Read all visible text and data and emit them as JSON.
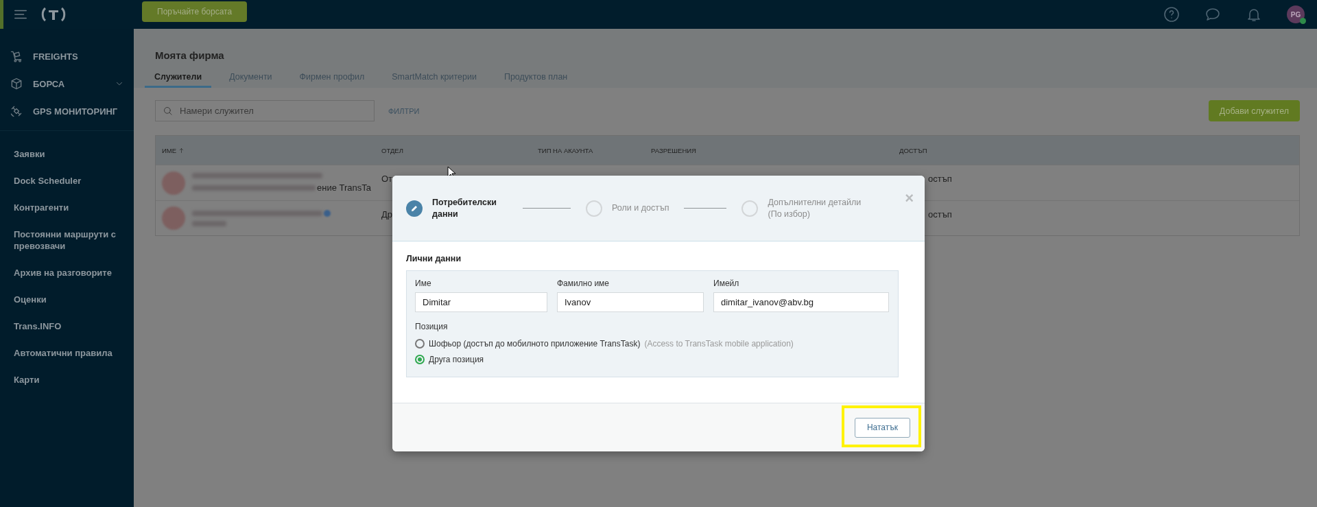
{
  "topbar": {
    "order_button": "Поръчайте борсата",
    "avatar": "PG",
    "online": true
  },
  "sidebar": {
    "main_items": [
      {
        "label": "FREIGHTS",
        "kind": "freights",
        "expandable": false
      },
      {
        "label": "БОРСА",
        "kind": "exchange",
        "expandable": true
      },
      {
        "label": "GPS МОНИТОРИНГ",
        "kind": "gps",
        "expandable": false
      }
    ],
    "items": [
      "Заявки",
      "Dock Scheduler",
      "Контрагенти",
      "Постоянни маршрути с превозвачи",
      "Архив на разговорите",
      "Оценки",
      "Trans.INFO",
      "Автоматични правила",
      "Карти"
    ]
  },
  "page": {
    "title": "Моята фирма",
    "tabs": [
      {
        "label": "Служители",
        "selected": true
      },
      {
        "label": "Документи",
        "selected": false
      },
      {
        "label": "Фирмен профил",
        "selected": false
      },
      {
        "label": "SmartMatch критерии",
        "selected": false
      },
      {
        "label": "Продуктов план",
        "selected": false
      }
    ],
    "search": {
      "placeholder": "Намери служител"
    },
    "filters": "ФИЛТРИ",
    "add_button": "Добави служител",
    "table": {
      "columns": [
        {
          "label": "ИМЕ",
          "sorted": true
        },
        {
          "label": "ОТДЕЛ",
          "sorted": false
        },
        {
          "label": "ТИП НА АКАУНТА",
          "sorted": false
        },
        {
          "label": "РАЗРЕШЕНИЯ",
          "sorted": false
        },
        {
          "label": "ДОСТЪП",
          "sorted": false
        }
      ],
      "rows": [
        {
          "subtitle_tail": "ение TransTa",
          "department": "От",
          "access": "остъп",
          "verified": false
        },
        {
          "department": "Др",
          "access": "остъп",
          "verified": true
        }
      ]
    }
  },
  "modal": {
    "steps": [
      {
        "label": "Потребителски данни",
        "active": true
      },
      {
        "label": "Роли и достъп",
        "active": false
      },
      {
        "label": "Допълнителни детайли",
        "note": "(По избор)",
        "active": false
      }
    ],
    "close": "×",
    "section_title": "Лични данни",
    "fields": [
      {
        "label": "Име",
        "value": "Dimitar"
      },
      {
        "label": "Фамилно име",
        "value": "Ivanov"
      },
      {
        "label": "Имейл",
        "value": "dimitar_ivanov@abv.bg"
      }
    ],
    "position": {
      "label": "Позиция",
      "options": [
        {
          "label": "Шофьор (достъп до мобилното приложение TransTask)",
          "note": "(Access to TransTask mobile application)",
          "selected": false
        },
        {
          "label": "Друга позиция",
          "selected": true
        }
      ]
    },
    "next_button": "Нататък",
    "next_highlighted": true
  }
}
